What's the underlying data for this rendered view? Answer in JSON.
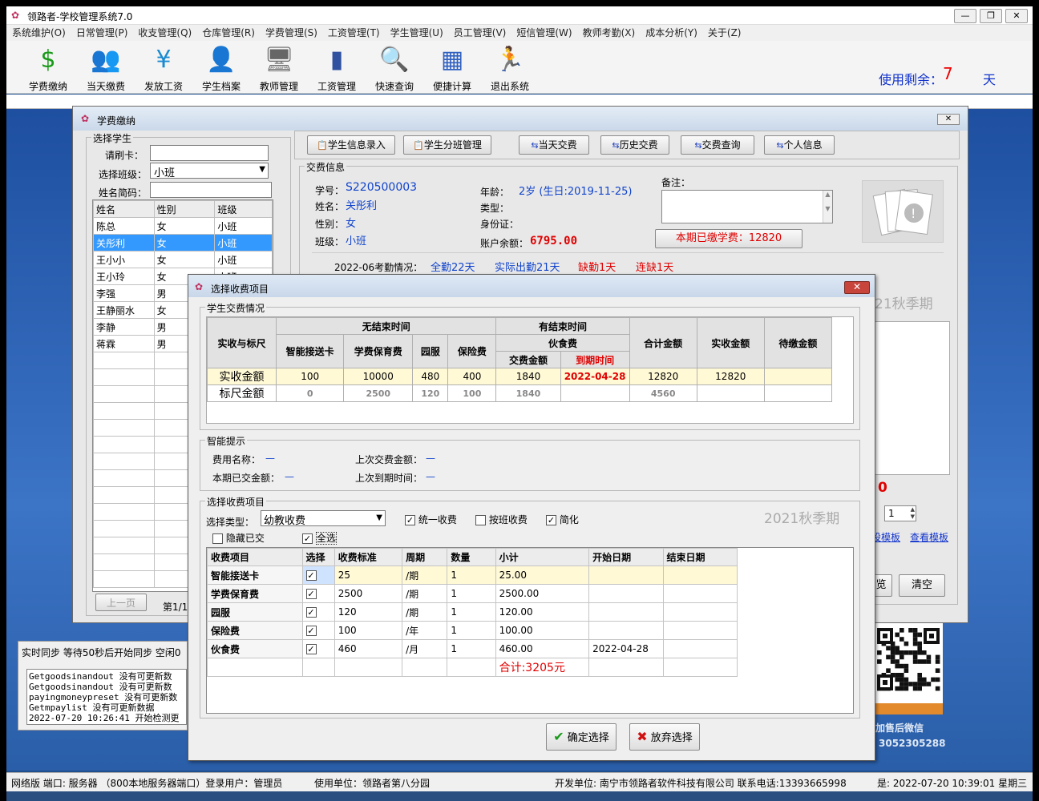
{
  "window": {
    "title": "领路者-学校管理系统7.0"
  },
  "menu": [
    "系统维护(O)",
    "日常管理(P)",
    "收支管理(Q)",
    "仓库管理(R)",
    "学费管理(S)",
    "工资管理(T)",
    "学生管理(U)",
    "员工管理(V)",
    "短信管理(W)",
    "教师考勤(X)",
    "成本分析(Y)",
    "关于(Z)"
  ],
  "toolbar": [
    {
      "label": "学费缴纳",
      "icon": "dollar-icon",
      "glyph": "$",
      "color": "#1a9a1a"
    },
    {
      "label": "当天缴费",
      "icon": "people-icon",
      "glyph": "👥",
      "color": "#c04040"
    },
    {
      "label": "发放工资",
      "icon": "yen-icon",
      "glyph": "¥",
      "color": "#1a8ad0"
    },
    {
      "label": "学生档案",
      "icon": "person-icon",
      "glyph": "👤",
      "color": "#444444"
    },
    {
      "label": "教师管理",
      "icon": "computer-icon",
      "glyph": "🖥",
      "color": "#666666"
    },
    {
      "label": "工资管理",
      "icon": "chart-icon",
      "glyph": "▮",
      "color": "#3050a0"
    },
    {
      "label": "快速查询",
      "icon": "magnifier-icon",
      "glyph": "🔍",
      "color": "#2080c0"
    },
    {
      "label": "便捷计算",
      "icon": "calculator-icon",
      "glyph": "▦",
      "color": "#3060c0"
    },
    {
      "label": "退出系统",
      "icon": "runner-icon",
      "glyph": "🏃",
      "color": "#e0a000"
    }
  ],
  "usage": {
    "label": "使用剩余：",
    "days": "7",
    "unit": "天"
  },
  "mainwin": {
    "title": "学费缴纳",
    "select_group": "选择学生",
    "card_label": "请刷卡：",
    "class_label": "选择班级：",
    "class_value": "小班",
    "abbr_label": "姓名简码：",
    "list_headers": [
      "姓名",
      "性别",
      "班级"
    ],
    "students": [
      [
        "陈总",
        "女",
        "小班"
      ],
      [
        "关彤利",
        "女",
        "小班"
      ],
      [
        "王小小",
        "女",
        "小班"
      ],
      [
        "王小玲",
        "女",
        "小班"
      ],
      [
        "李强",
        "男",
        ""
      ],
      [
        "王静丽水",
        "女",
        ""
      ],
      [
        "李静",
        "男",
        ""
      ],
      [
        "蒋霖",
        "男",
        ""
      ]
    ],
    "prev_page": "上一页",
    "page_info": "第1/1",
    "tabs": [
      "学生信息录入",
      "学生分班管理",
      "当天交费",
      "历史交费",
      "交费查询",
      "个人信息"
    ],
    "info_group": "交费信息",
    "student_no_label": "学号：",
    "student_no": "S220500003",
    "name_label": "姓名：",
    "name": "关彤利",
    "gender_label": "性别：",
    "gender": "女",
    "class2_label": "班级：",
    "class2": "小班",
    "age_label": "年龄：",
    "age": "2岁 (生日:2019-11-25)",
    "type_label": "类型：",
    "id_label": "身份证：",
    "balance_label": "账户余额：",
    "balance": "6795.00",
    "remark_label": "备注：",
    "paid_label": "本期已缴学费：",
    "paid": "12820",
    "attendance_label": "2022-06考勤情况：",
    "att_full": "全勤22天",
    "att_actual": "实际出勤21天",
    "att_absent": "缺勤1天",
    "att_continuous": "连缺1天",
    "season_partial": "21秋季期",
    "red_zero": "0",
    "spin_value": "1",
    "tpl_set": "设模板",
    "tpl_view": "查看模板",
    "btn_preview": "览",
    "btn_clear": "清空"
  },
  "sync": {
    "title": "实时同步 等待50秒后开始同步 空闲0",
    "lines": [
      "Getgoodsinandout 没有可更新数",
      "Getgoodsinandout 没有可更新数",
      "payingmoneypreset 没有可更新数",
      "Getmpaylist 没有可更新数据",
      "2022-07-20 10:26:41 开始检测更"
    ]
  },
  "qr": {
    "caption": "加售后微信",
    "phone": "3052305288"
  },
  "dialog": {
    "title": "选择收费项目",
    "situation_group": "学生交费情况",
    "h_row_label": "实收与标尺",
    "h_no_end": "无结束时间",
    "h_has_end": "有结束时间",
    "h_cols": [
      "智能接送卡",
      "学费保育费",
      "园服",
      "保险费"
    ],
    "h_food": "伙食费",
    "h_food_amount": "交费金额",
    "h_food_due": "到期时间",
    "h_total": "合计金额",
    "h_actual": "实收金额",
    "h_pending": "待缴金额",
    "row_actual": {
      "label": "实收金额",
      "v": [
        "100",
        "10000",
        "480",
        "400",
        "1840",
        "2022-04-28",
        "12820",
        "12820",
        ""
      ]
    },
    "row_std": {
      "label": "标尺金额",
      "v": [
        "0",
        "2500",
        "120",
        "100",
        "1840",
        "",
        "4560",
        "",
        ""
      ]
    },
    "hint_group": "智能提示",
    "hint_fee_name": "费用名称：",
    "hint_fee_name_v": "—",
    "hint_last_amount": "上次交费金额：",
    "hint_last_amount_v": "—",
    "hint_paid": "本期已交金额：",
    "hint_paid_v": "—",
    "hint_last_due": "上次到期时间：",
    "hint_last_due_v": "—",
    "items_group": "选择收费项目",
    "type_label": "选择类型：",
    "type_value": "幼教收费",
    "opt_unified": "统一收费",
    "opt_byclass": "按班收费",
    "opt_simple": "简化",
    "opt_hide_paid": "隐藏已交",
    "opt_select_all": "全选",
    "season": "2021秋季期",
    "f_headers": [
      "收费项目",
      "选择",
      "收费标准",
      "周期",
      "数量",
      "小计",
      "开始日期",
      "结束日期"
    ],
    "fees": [
      {
        "name": "智能接送卡",
        "std": "25",
        "period": "/期",
        "qty": "1",
        "sub": "25.00",
        "start": "",
        "end": ""
      },
      {
        "name": "学费保育费",
        "std": "2500",
        "period": "/期",
        "qty": "1",
        "sub": "2500.00",
        "start": "",
        "end": ""
      },
      {
        "name": "园服",
        "std": "120",
        "period": "/期",
        "qty": "1",
        "sub": "120.00",
        "start": "",
        "end": ""
      },
      {
        "name": "保险费",
        "std": "100",
        "period": "/年",
        "qty": "1",
        "sub": "100.00",
        "start": "",
        "end": ""
      },
      {
        "name": "伙食费",
        "std": "460",
        "period": "/月",
        "qty": "1",
        "sub": "460.00",
        "start": "2022-04-28",
        "end": ""
      }
    ],
    "total": "合计:3205元",
    "ok": "确定选择",
    "cancel": "放弃选择"
  },
  "status": {
    "s1": "网络版 端口: 服务器 （800本地服务器端口）登录用户：管理员",
    "s2": "使用单位：领路者第八分园",
    "s3": "开发单位: 南宁市领路者软件科技有限公司 联系电话:13393665998",
    "s4": "是: 2022-07-20 10:39:01 星期三"
  }
}
